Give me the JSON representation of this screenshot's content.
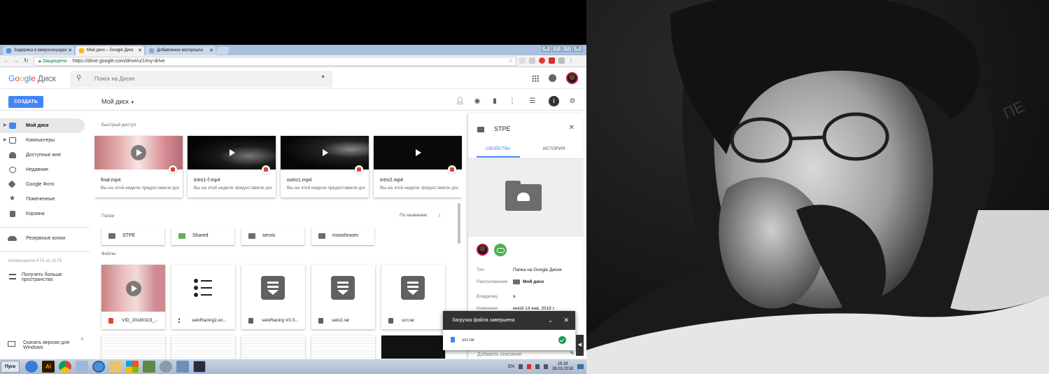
{
  "browser": {
    "tabs": [
      {
        "title": "Задержка в микросекундах"
      },
      {
        "title": "Мой диск – Google Диск"
      },
      {
        "title": "Добавление материала"
      }
    ],
    "address": {
      "secure_label": "Защищено",
      "url": "https://drive.google.com/drive/u/1/my-drive"
    }
  },
  "drive": {
    "logo_google": [
      "G",
      "o",
      "o",
      "g",
      "l",
      "e"
    ],
    "logo_product": "Диск",
    "search_placeholder": "Поиск на Диске",
    "create_label": "СОЗДАТЬ",
    "location_title": "Мой диск",
    "sidebar": {
      "items": [
        {
          "label": "Мой диск",
          "icon": "drive-icon",
          "active": true
        },
        {
          "label": "Компьютеры",
          "icon": "computer-icon"
        },
        {
          "label": "Доступные мне",
          "icon": "people-icon"
        },
        {
          "label": "Недавние",
          "icon": "clock-icon"
        },
        {
          "label": "Google Фото",
          "icon": "pinwheel-icon"
        },
        {
          "label": "Помеченные",
          "icon": "star-icon"
        },
        {
          "label": "Корзина",
          "icon": "trash-icon"
        }
      ],
      "backups": "Резервные копии",
      "usage": "Используется 4 ГБ из 15 ГБ",
      "more_storage": "Получить больше пространства",
      "download_app": "Скачать версию для Windows"
    },
    "quick_access": {
      "label": "Быстрый доступ",
      "cards": [
        {
          "name": "final.mp4",
          "sub": "Вы на этой неделе предоставили доступ"
        },
        {
          "name": "intro1-f.mp4",
          "sub": "Вы на этой неделе предоставили доступ"
        },
        {
          "name": "outro1.mp4",
          "sub": "Вы на этой неделе предоставили доступ"
        },
        {
          "name": "intro2.mp4",
          "sub": "Вы на этой неделе предоставили доступ"
        }
      ]
    },
    "folders": {
      "label": "Папки",
      "sort_label": "По названию",
      "items": [
        "STPE",
        "Shared",
        "servis",
        "mooshroom"
      ]
    },
    "files": {
      "label": "Файлы",
      "items": [
        "VID_20180323_...",
        "seloRacing2.ex...",
        "seloRacing V2.0...",
        "selo2.rar",
        "scr.rar"
      ]
    },
    "details": {
      "title": "STPE",
      "tab_properties": "СВОЙСТВА",
      "tab_history": "ИСТОРИЯ",
      "rows": [
        {
          "label": "Тип",
          "value": "Папка на Google Диске"
        },
        {
          "label": "Расположение",
          "value": "Мой диск"
        },
        {
          "label": "Владелец",
          "value": "я"
        },
        {
          "label": "Изменено",
          "value": "мной 14 янв. 2018 г."
        }
      ],
      "description_placeholder": "Добавить описание"
    },
    "upload_toast": {
      "title": "Загрузка файла завершена",
      "file": "scr.rar"
    }
  },
  "taskbar": {
    "start_label": "Пуск",
    "lang": "EN",
    "time": "19:28",
    "date": "28.03.2018"
  },
  "colors": {
    "accent": "#4285f4",
    "ok": "#0f9d58",
    "video": "#db4437"
  }
}
